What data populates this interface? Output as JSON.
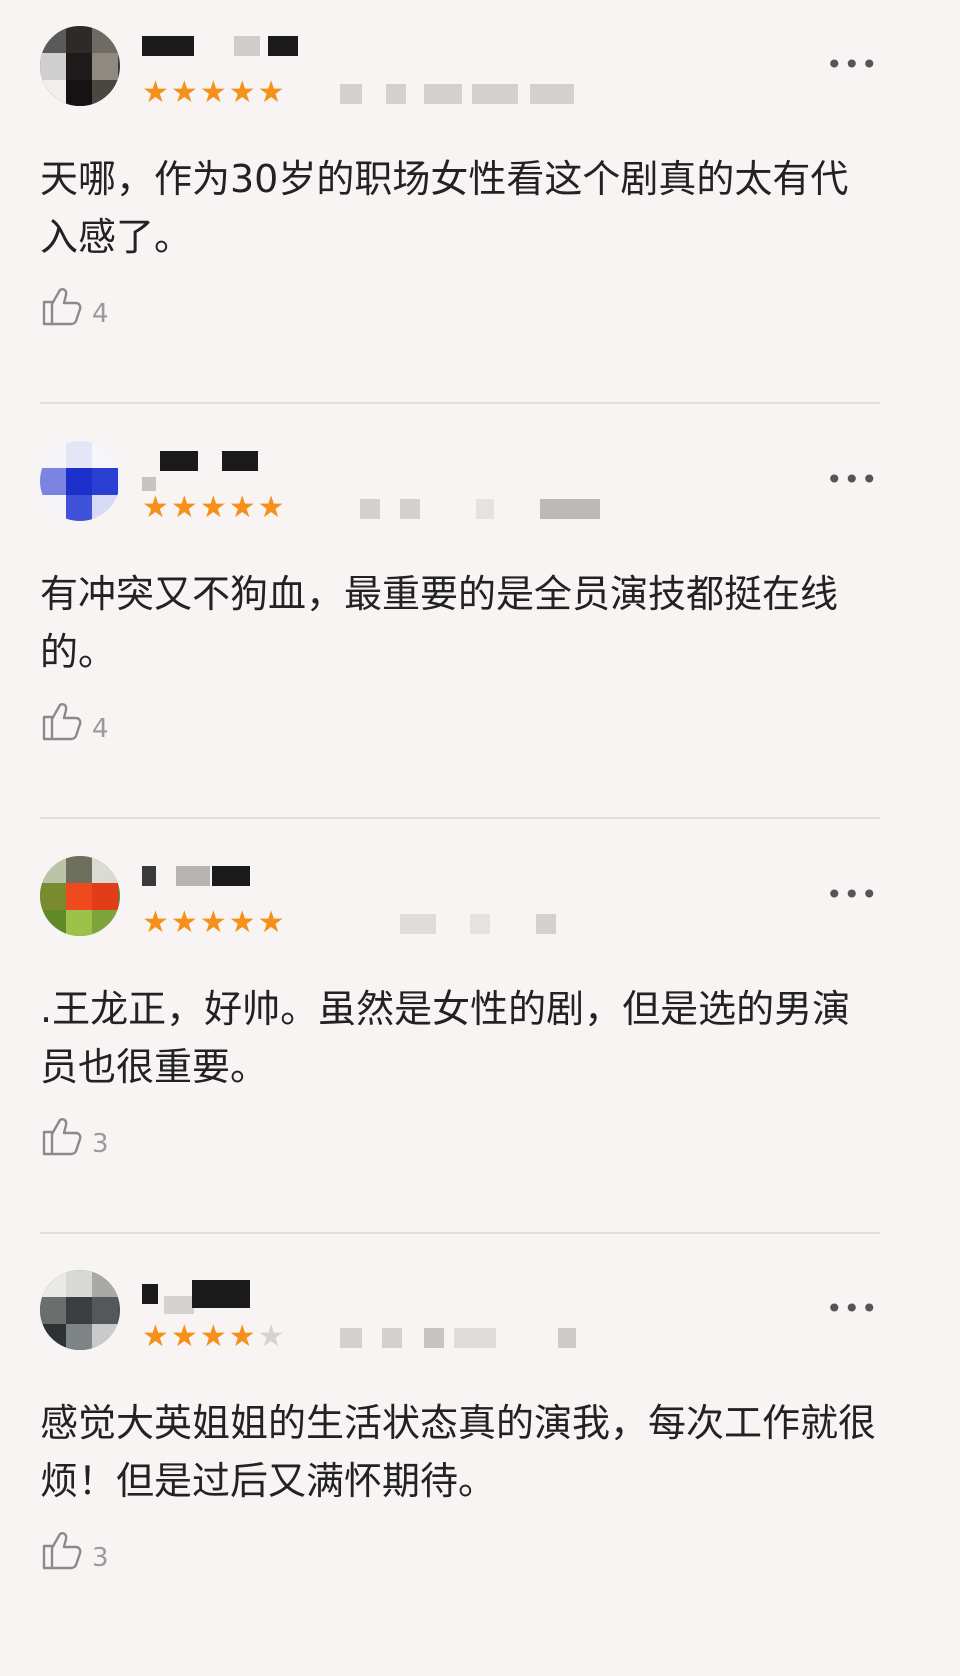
{
  "comments": [
    {
      "stars": 5,
      "text": "天哪，作为30岁的职场女性看这个剧真的太有代入感了。",
      "likes": "4",
      "more_label": "•••"
    },
    {
      "stars": 5,
      "text": "有冲突又不狗血，最重要的是全员演技都挺在线的。",
      "likes": "4",
      "more_label": "•••"
    },
    {
      "stars": 5,
      "text": ".王龙正，好帅。虽然是女性的剧，但是选的男演员也很重要。",
      "likes": "3",
      "more_label": "•••"
    },
    {
      "stars": 4,
      "text": "感觉大英姐姐的生活状态真的演我，每次工作就很烦！但是过后又满怀期待。",
      "likes": "3",
      "more_label": "•••"
    }
  ],
  "colors": {
    "background": "#f8f4f3",
    "star_on": "#f5901a",
    "star_off": "#d6d2d0",
    "text": "#222222",
    "muted": "#9a9a9a"
  },
  "icons": {
    "like": "thumbs-up-icon",
    "more": "more-dots-icon",
    "star": "star-icon"
  }
}
